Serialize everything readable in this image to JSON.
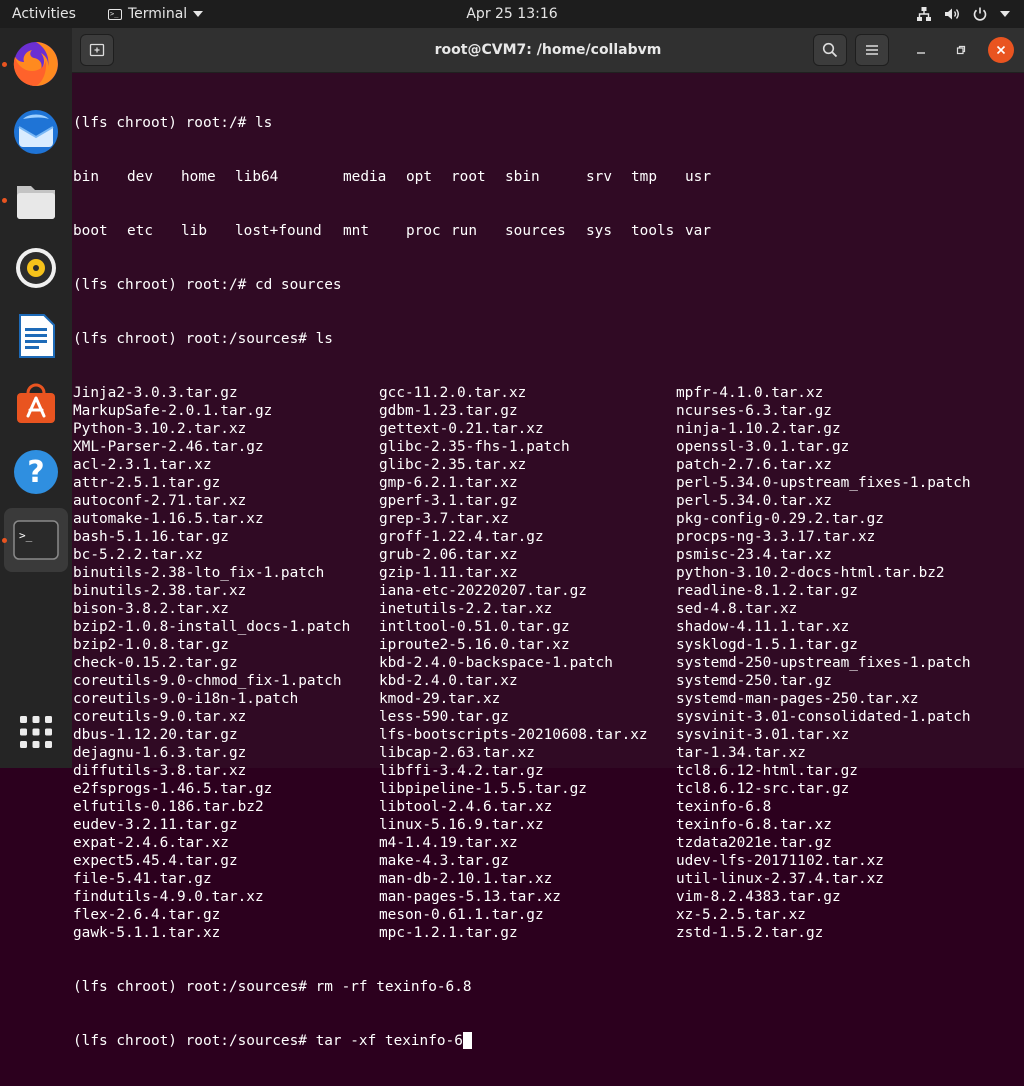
{
  "topbar": {
    "activities": "Activities",
    "app_name": "Terminal",
    "clock": "Apr 25  13:16"
  },
  "dock": {
    "apps": [
      "firefox-icon",
      "thunderbird-icon",
      "files-icon",
      "rhythmbox-icon",
      "writer-icon",
      "software-icon",
      "help-icon",
      "terminal-icon"
    ],
    "running": [
      "firefox",
      "files",
      "terminal"
    ],
    "accent_color": "#e95420"
  },
  "window": {
    "title": "root@CVM7: /home/collabvm"
  },
  "terminal": {
    "prompt1": "(lfs chroot) root:/# ls",
    "root_ls_row1": [
      "bin",
      "dev",
      "home",
      "lib64",
      "media",
      "opt",
      "root",
      "sbin",
      "srv",
      "tmp",
      "usr"
    ],
    "root_ls_row2": [
      "boot",
      "etc",
      "lib",
      "lost+found",
      "mnt",
      "proc",
      "run",
      "sources",
      "sys",
      "tools",
      "var"
    ],
    "prompt2": "(lfs chroot) root:/# cd sources",
    "prompt3": "(lfs chroot) root:/sources# ls",
    "rows": [
      [
        "Jinja2-3.0.3.tar.gz",
        "gcc-11.2.0.tar.xz",
        "mpfr-4.1.0.tar.xz"
      ],
      [
        "MarkupSafe-2.0.1.tar.gz",
        "gdbm-1.23.tar.gz",
        "ncurses-6.3.tar.gz"
      ],
      [
        "Python-3.10.2.tar.xz",
        "gettext-0.21.tar.xz",
        "ninja-1.10.2.tar.gz"
      ],
      [
        "XML-Parser-2.46.tar.gz",
        "glibc-2.35-fhs-1.patch",
        "openssl-3.0.1.tar.gz"
      ],
      [
        "acl-2.3.1.tar.xz",
        "glibc-2.35.tar.xz",
        "patch-2.7.6.tar.xz"
      ],
      [
        "attr-2.5.1.tar.gz",
        "gmp-6.2.1.tar.xz",
        "perl-5.34.0-upstream_fixes-1.patch"
      ],
      [
        "autoconf-2.71.tar.xz",
        "gperf-3.1.tar.gz",
        "perl-5.34.0.tar.xz"
      ],
      [
        "automake-1.16.5.tar.xz",
        "grep-3.7.tar.xz",
        "pkg-config-0.29.2.tar.gz"
      ],
      [
        "bash-5.1.16.tar.gz",
        "groff-1.22.4.tar.gz",
        "procps-ng-3.3.17.tar.xz"
      ],
      [
        "bc-5.2.2.tar.xz",
        "grub-2.06.tar.xz",
        "psmisc-23.4.tar.xz"
      ],
      [
        "binutils-2.38-lto_fix-1.patch",
        "gzip-1.11.tar.xz",
        "python-3.10.2-docs-html.tar.bz2"
      ],
      [
        "binutils-2.38.tar.xz",
        "iana-etc-20220207.tar.gz",
        "readline-8.1.2.tar.gz"
      ],
      [
        "bison-3.8.2.tar.xz",
        "inetutils-2.2.tar.xz",
        "sed-4.8.tar.xz"
      ],
      [
        "bzip2-1.0.8-install_docs-1.patch",
        "intltool-0.51.0.tar.gz",
        "shadow-4.11.1.tar.xz"
      ],
      [
        "bzip2-1.0.8.tar.gz",
        "iproute2-5.16.0.tar.xz",
        "sysklogd-1.5.1.tar.gz"
      ],
      [
        "check-0.15.2.tar.gz",
        "kbd-2.4.0-backspace-1.patch",
        "systemd-250-upstream_fixes-1.patch"
      ],
      [
        "coreutils-9.0-chmod_fix-1.patch",
        "kbd-2.4.0.tar.xz",
        "systemd-250.tar.gz"
      ],
      [
        "coreutils-9.0-i18n-1.patch",
        "kmod-29.tar.xz",
        "systemd-man-pages-250.tar.xz"
      ],
      [
        "coreutils-9.0.tar.xz",
        "less-590.tar.gz",
        "sysvinit-3.01-consolidated-1.patch"
      ],
      [
        "dbus-1.12.20.tar.gz",
        "lfs-bootscripts-20210608.tar.xz",
        "sysvinit-3.01.tar.xz"
      ],
      [
        "dejagnu-1.6.3.tar.gz",
        "libcap-2.63.tar.xz",
        "tar-1.34.tar.xz"
      ],
      [
        "diffutils-3.8.tar.xz",
        "libffi-3.4.2.tar.gz",
        "tcl8.6.12-html.tar.gz"
      ],
      [
        "e2fsprogs-1.46.5.tar.gz",
        "libpipeline-1.5.5.tar.gz",
        "tcl8.6.12-src.tar.gz"
      ],
      [
        "elfutils-0.186.tar.bz2",
        "libtool-2.4.6.tar.xz",
        "texinfo-6.8"
      ],
      [
        "eudev-3.2.11.tar.gz",
        "linux-5.16.9.tar.xz",
        "texinfo-6.8.tar.xz"
      ],
      [
        "expat-2.4.6.tar.xz",
        "m4-1.4.19.tar.xz",
        "tzdata2021e.tar.gz"
      ],
      [
        "expect5.45.4.tar.gz",
        "make-4.3.tar.gz",
        "udev-lfs-20171102.tar.xz"
      ],
      [
        "file-5.41.tar.gz",
        "man-db-2.10.1.tar.xz",
        "util-linux-2.37.4.tar.xz"
      ],
      [
        "findutils-4.9.0.tar.xz",
        "man-pages-5.13.tar.xz",
        "vim-8.2.4383.tar.gz"
      ],
      [
        "flex-2.6.4.tar.gz",
        "meson-0.61.1.tar.gz",
        "xz-5.2.5.tar.xz"
      ],
      [
        "gawk-5.1.1.tar.xz",
        "mpc-1.2.1.tar.gz",
        "zstd-1.5.2.tar.gz"
      ]
    ],
    "prompt4": "(lfs chroot) root:/sources# rm -rf texinfo-6.8",
    "prompt5": "(lfs chroot) root:/sources# tar -xf texinfo-6"
  }
}
